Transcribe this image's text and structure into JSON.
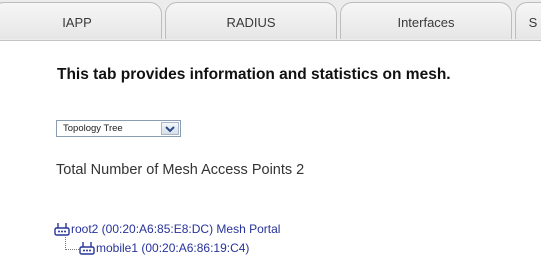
{
  "tabs": [
    {
      "label": "IAPP"
    },
    {
      "label": "RADIUS"
    },
    {
      "label": "Interfaces"
    },
    {
      "label": "S"
    }
  ],
  "intro_text": "This tab provides information and statistics on mesh.",
  "view_select": {
    "selected": "Topology Tree"
  },
  "total_label": "Total Number of Mesh Access Points 2",
  "tree": [
    {
      "label": "root2 (00:20:A6:85:E8:DC) Mesh Portal",
      "icon": "access-point-icon"
    },
    {
      "label": "mobile1 (00:20:A6:86:19:C4)",
      "icon": "access-point-icon"
    }
  ],
  "colors": {
    "link": "#27339a",
    "tab_border": "#bdbdbd"
  }
}
